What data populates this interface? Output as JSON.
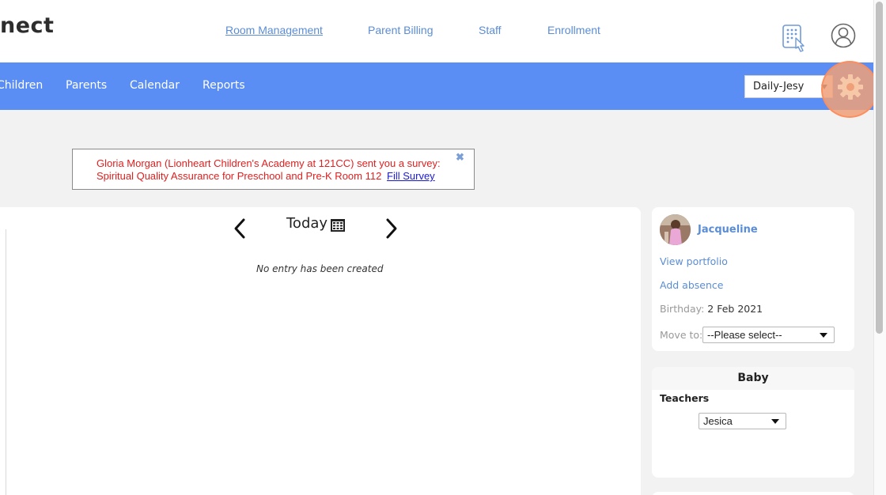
{
  "header": {
    "logo_text": "nect",
    "links": [
      "Room Management",
      "Parent Billing",
      "Staff",
      "Enrollment"
    ],
    "active_link": "Room Management"
  },
  "nav": {
    "items": [
      "Children",
      "Parents",
      "Calendar",
      "Reports"
    ],
    "room_select_value": "Daily-Jesy"
  },
  "banner": {
    "line1": "Gloria Morgan (Lionheart Children's Academy at 121CC) sent you a survey:",
    "line2": "Spiritual Quality Assurance for Preschool and Pre-K Room 112",
    "link": "Fill Survey",
    "close": "✖"
  },
  "main": {
    "date_label": "Today",
    "empty_message": "No entry has been created"
  },
  "child_card": {
    "name": "Jacqueline",
    "view_portfolio": "View portfolio",
    "add_absence": "Add absence",
    "birthday_label": "Birthday:",
    "birthday_value": "2 Feb 2021",
    "move_to_label": "Move to:",
    "move_to_value": "--Please select--"
  },
  "room_card": {
    "room_name": "Baby",
    "teachers_label": "Teachers",
    "teacher_value": "Jesica"
  },
  "colors": {
    "nav_blue": "#5b8ef5",
    "link_blue": "#5a8dd6",
    "alert_red": "#e02020",
    "highlight_orange": "#f0a078"
  }
}
